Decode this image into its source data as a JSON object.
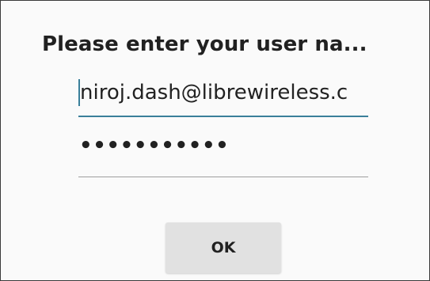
{
  "dialog": {
    "title": "Please enter your user na...",
    "username_value": "niroj.dash@librewireless.c",
    "password_masked": "•••••••••••",
    "ok_label": "OK"
  },
  "colors": {
    "accent": "#3a7f9a",
    "background": "#fafafa",
    "button": "#e1e1e1"
  }
}
